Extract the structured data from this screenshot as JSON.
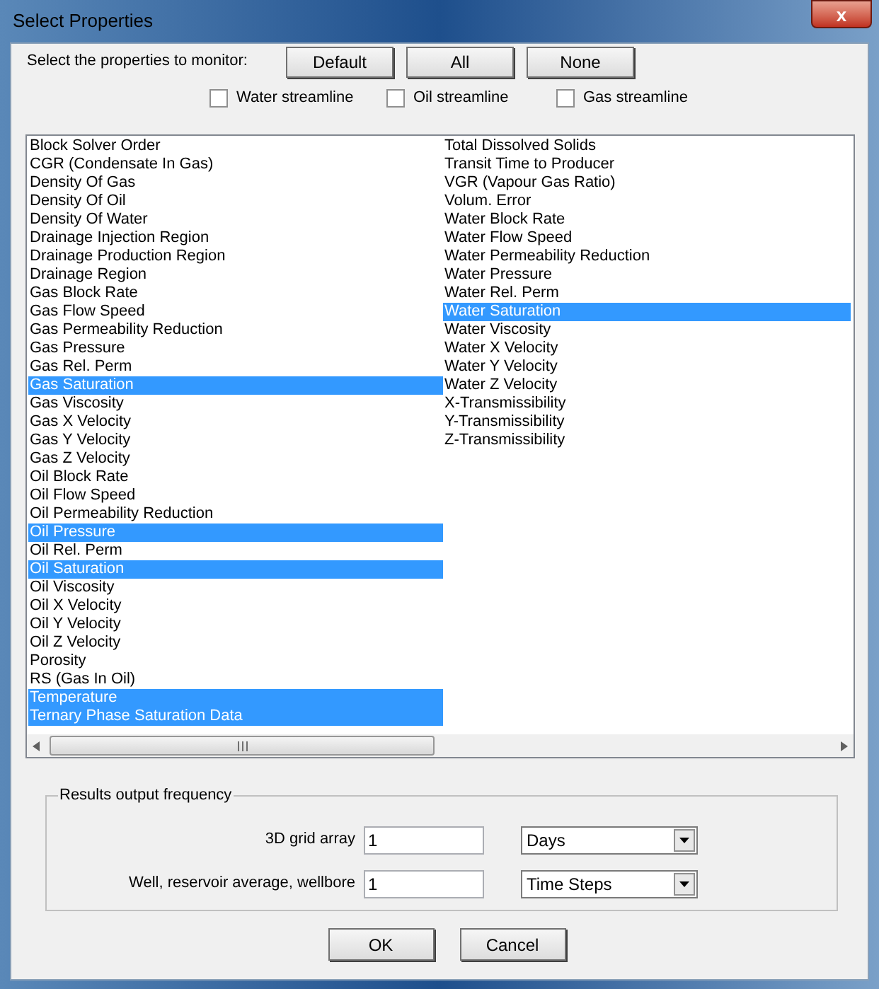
{
  "window": {
    "title": "Select Properties",
    "close_glyph": "x"
  },
  "prompt": "Select the properties to monitor:",
  "top_buttons": [
    "Default",
    "All",
    "None"
  ],
  "streamlines": [
    {
      "label": "Water streamline",
      "checked": false
    },
    {
      "label": "Oil streamline",
      "checked": false
    },
    {
      "label": "Gas streamline",
      "checked": false
    }
  ],
  "properties": [
    {
      "label": "Block Solver Order",
      "selected": false
    },
    {
      "label": "CGR (Condensate In Gas)",
      "selected": false
    },
    {
      "label": "Density Of Gas",
      "selected": false
    },
    {
      "label": "Density Of Oil",
      "selected": false
    },
    {
      "label": "Density Of Water",
      "selected": false
    },
    {
      "label": "Drainage Injection Region",
      "selected": false
    },
    {
      "label": "Drainage Production Region",
      "selected": false
    },
    {
      "label": "Drainage Region",
      "selected": false
    },
    {
      "label": "Gas Block Rate",
      "selected": false
    },
    {
      "label": "Gas Flow Speed",
      "selected": false
    },
    {
      "label": "Gas Permeability Reduction",
      "selected": false
    },
    {
      "label": "Gas Pressure",
      "selected": false
    },
    {
      "label": "Gas Rel. Perm",
      "selected": false
    },
    {
      "label": "Gas Saturation",
      "selected": true
    },
    {
      "label": "Gas Viscosity",
      "selected": false
    },
    {
      "label": "Gas X Velocity",
      "selected": false
    },
    {
      "label": "Gas Y Velocity",
      "selected": false
    },
    {
      "label": "Gas Z Velocity",
      "selected": false
    },
    {
      "label": "Oil Block Rate",
      "selected": false
    },
    {
      "label": "Oil Flow Speed",
      "selected": false
    },
    {
      "label": "Oil Permeability Reduction",
      "selected": false
    },
    {
      "label": "Oil Pressure",
      "selected": true
    },
    {
      "label": "Oil Rel. Perm",
      "selected": false
    },
    {
      "label": "Oil Saturation",
      "selected": true
    },
    {
      "label": "Oil Viscosity",
      "selected": false
    },
    {
      "label": "Oil X Velocity",
      "selected": false
    },
    {
      "label": "Oil Y Velocity",
      "selected": false
    },
    {
      "label": "Oil Z Velocity",
      "selected": false
    },
    {
      "label": "Porosity",
      "selected": false
    },
    {
      "label": "RS (Gas In Oil)",
      "selected": false
    },
    {
      "label": "Temperature",
      "selected": true
    },
    {
      "label": "Ternary Phase Saturation Data",
      "selected": true
    },
    {
      "label": "Total Dissolved Solids",
      "selected": false
    },
    {
      "label": "Transit Time to Producer",
      "selected": false
    },
    {
      "label": "VGR (Vapour Gas Ratio)",
      "selected": false
    },
    {
      "label": "Volum. Error",
      "selected": false
    },
    {
      "label": "Water Block Rate",
      "selected": false
    },
    {
      "label": "Water Flow Speed",
      "selected": false
    },
    {
      "label": "Water Permeability Reduction",
      "selected": false
    },
    {
      "label": "Water Pressure",
      "selected": false
    },
    {
      "label": "Water Rel. Perm",
      "selected": false
    },
    {
      "label": "Water Saturation",
      "selected": true
    },
    {
      "label": "Water Viscosity",
      "selected": false
    },
    {
      "label": "Water X Velocity",
      "selected": false
    },
    {
      "label": "Water Y Velocity",
      "selected": false
    },
    {
      "label": "Water Z Velocity",
      "selected": false
    },
    {
      "label": "X-Transmissibility",
      "selected": false
    },
    {
      "label": "Y-Transmissibility",
      "selected": false
    },
    {
      "label": "Z-Transmissibility",
      "selected": false
    }
  ],
  "output_frequency": {
    "title": "Results output frequency",
    "rows": [
      {
        "label": "3D grid array",
        "value": "1",
        "unit": "Days"
      },
      {
        "label": "Well, reservoir average, wellbore",
        "value": "1",
        "unit": "Time Steps"
      }
    ]
  },
  "buttons": [
    "OK",
    "Cancel"
  ]
}
